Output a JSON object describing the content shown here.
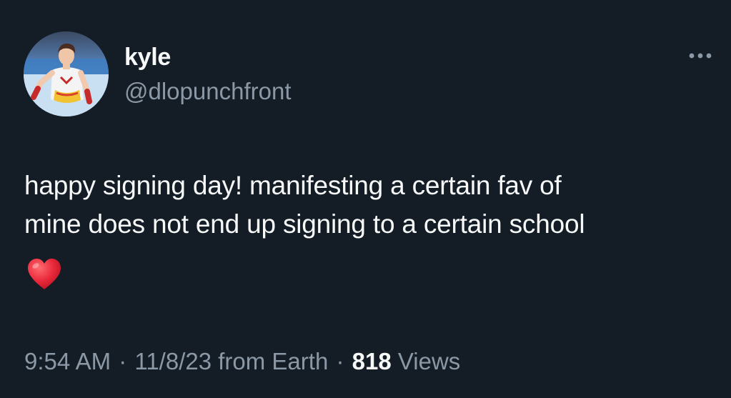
{
  "tweet": {
    "author": {
      "display_name": "kyle",
      "handle": "@dlopunchfront",
      "avatar_icon": "profile-photo"
    },
    "more_icon": "more-horizontal-icon",
    "text_lines": [
      "happy signing day! manifesting a certain fav of",
      "mine does not end up signing to a certain school"
    ],
    "emoji": "❤️",
    "time": "9:54 AM",
    "separator": "·",
    "date": "11/8/23",
    "source": "from Earth",
    "views_count": "818",
    "views_label": "Views"
  },
  "colors": {
    "background": "#141c26",
    "primary_text": "#f7f9f9",
    "secondary_text": "#8b98a5",
    "heart": "#e8283b"
  }
}
